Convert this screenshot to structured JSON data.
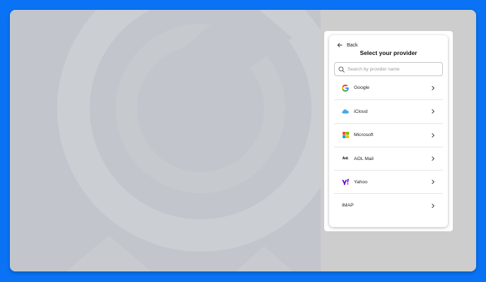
{
  "dialog": {
    "back_label": "Back",
    "title": "Select your provider",
    "search": {
      "placeholder": "Search by provider name",
      "value": ""
    },
    "providers": [
      {
        "label": "Google",
        "icon": "google-icon"
      },
      {
        "label": "iCloud",
        "icon": "icloud-icon"
      },
      {
        "label": "Microsoft",
        "icon": "microsoft-icon"
      },
      {
        "label": "AOL Mail",
        "icon": "aol-icon",
        "logo_text": "Aol."
      },
      {
        "label": "Yahoo",
        "icon": "yahoo-icon"
      },
      {
        "label": "IMAP",
        "icon": ""
      }
    ]
  },
  "colors": {
    "background": "#0a73f5",
    "left_panel": "#c2c6cc",
    "right_panel": "#cdcdcd",
    "dialog": "#ffffff"
  }
}
